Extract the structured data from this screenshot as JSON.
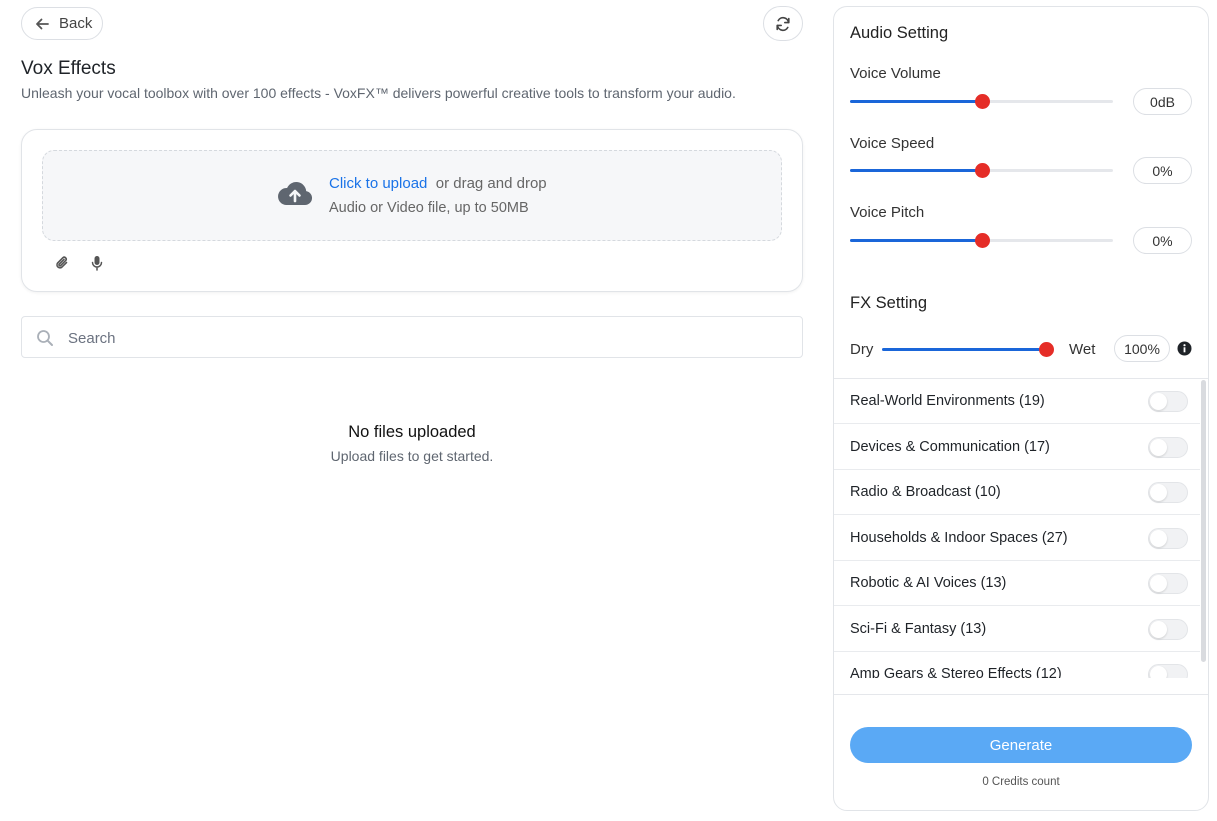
{
  "header": {
    "back_label": "Back",
    "title": "Vox Effects",
    "subtitle": "Unleash your vocal toolbox with over 100 effects - VoxFX™ delivers powerful creative tools to transform your audio."
  },
  "upload": {
    "link_text": "Click to upload",
    "drag_text": "or drag and drop",
    "hint": "Audio or Video file, up to 50MB"
  },
  "search": {
    "placeholder": "Search"
  },
  "empty_state": {
    "title": "No files uploaded",
    "subtitle": "Upload files to get started."
  },
  "audio_setting": {
    "title": "Audio Setting",
    "sliders": [
      {
        "label": "Voice Volume",
        "value": "0dB",
        "level": 0.5
      },
      {
        "label": "Voice Speed",
        "value": "0%",
        "level": 0.5
      },
      {
        "label": "Voice Pitch",
        "value": "0%",
        "level": 0.5
      }
    ]
  },
  "fx_setting": {
    "title": "FX Setting",
    "dry_label": "Dry",
    "wet_label": "Wet",
    "mix_value": "100%",
    "mix_level": 1.0
  },
  "fx_categories": [
    {
      "label": "Real-World Environments (19)",
      "enabled": false
    },
    {
      "label": "Devices & Communication (17)",
      "enabled": false
    },
    {
      "label": "Radio & Broadcast (10)",
      "enabled": false
    },
    {
      "label": "Households & Indoor Spaces (27)",
      "enabled": false
    },
    {
      "label": "Robotic & AI Voices (13)",
      "enabled": false
    },
    {
      "label": "Sci-Fi & Fantasy (13)",
      "enabled": false
    },
    {
      "label": "Amp Gears & Stereo Effects (12)",
      "enabled": false
    }
  ],
  "footer": {
    "generate_label": "Generate",
    "credits": "0 Credits count"
  },
  "colors": {
    "accent_blue": "#1a66d9",
    "slider_knob": "#e52d27",
    "generate_button": "#5aa9f5",
    "link": "#1a73e8"
  }
}
